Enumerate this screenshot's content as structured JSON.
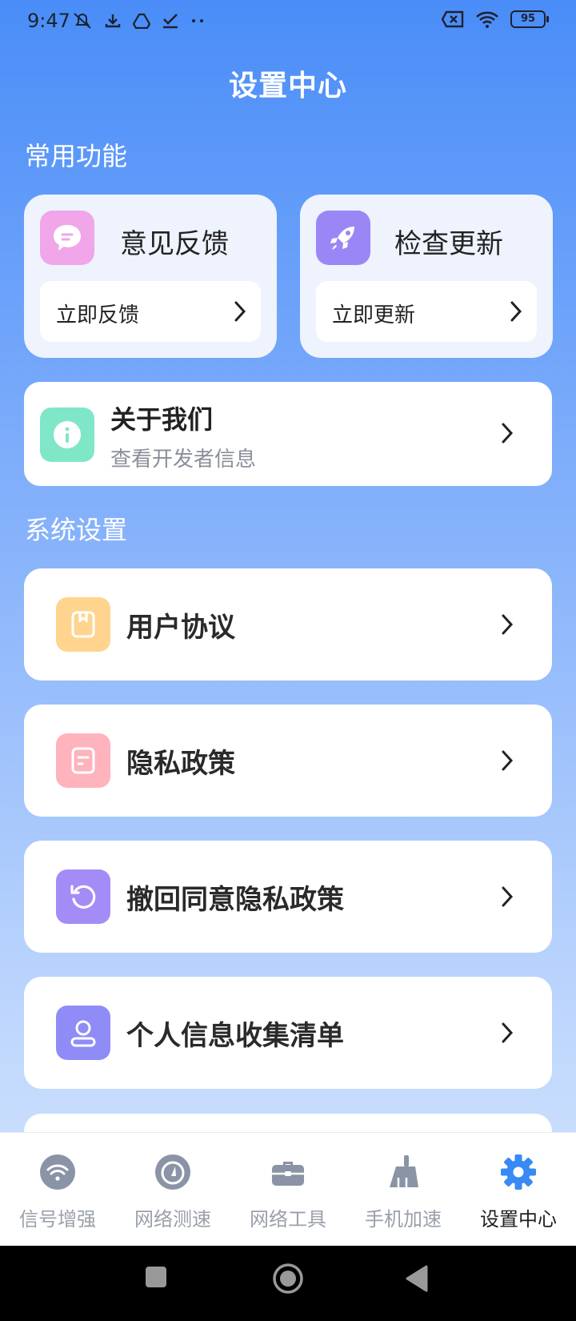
{
  "status_bar": {
    "time": "9:47",
    "battery": "95",
    "left_icons": [
      "mute-icon",
      "download-icon",
      "drive-icon",
      "check-icon",
      "more-dots-icon"
    ],
    "right_icons": [
      "sim-x-icon",
      "wifi-icon",
      "battery-icon"
    ]
  },
  "page": {
    "title": "设置中心"
  },
  "common": {
    "section_title": "常用功能",
    "feedback": {
      "title": "意见反馈",
      "button": "立即反馈",
      "icon": "chat-bubble-icon",
      "color": "#f0a6e8"
    },
    "update": {
      "title": "检查更新",
      "button": "立即更新",
      "icon": "rocket-icon",
      "color": "#9b86f6"
    },
    "about": {
      "title": "关于我们",
      "subtitle": "查看开发者信息",
      "icon": "info-icon",
      "color": "#7fe7c8"
    }
  },
  "system": {
    "section_title": "系统设置",
    "items": [
      {
        "label": "用户协议",
        "icon": "document-icon",
        "color": "#ffd48f"
      },
      {
        "label": "隐私政策",
        "icon": "file-text-icon",
        "color": "#ffb3bd"
      },
      {
        "label": "撤回同意隐私政策",
        "icon": "revoke-icon",
        "color": "#a48cf7"
      },
      {
        "label": "个人信息收集清单",
        "icon": "user-icon",
        "color": "#8f8cf7"
      }
    ]
  },
  "tabs": [
    {
      "label": "信号增强",
      "icon": "signal-icon",
      "active": false
    },
    {
      "label": "网络测速",
      "icon": "speedometer-icon",
      "active": false
    },
    {
      "label": "网络工具",
      "icon": "toolbox-icon",
      "active": false
    },
    {
      "label": "手机加速",
      "icon": "broom-icon",
      "active": false
    },
    {
      "label": "设置中心",
      "icon": "gear-icon",
      "active": true
    }
  ],
  "colors": {
    "accent": "#3a8af6",
    "tab_inactive": "#8a94a6"
  }
}
